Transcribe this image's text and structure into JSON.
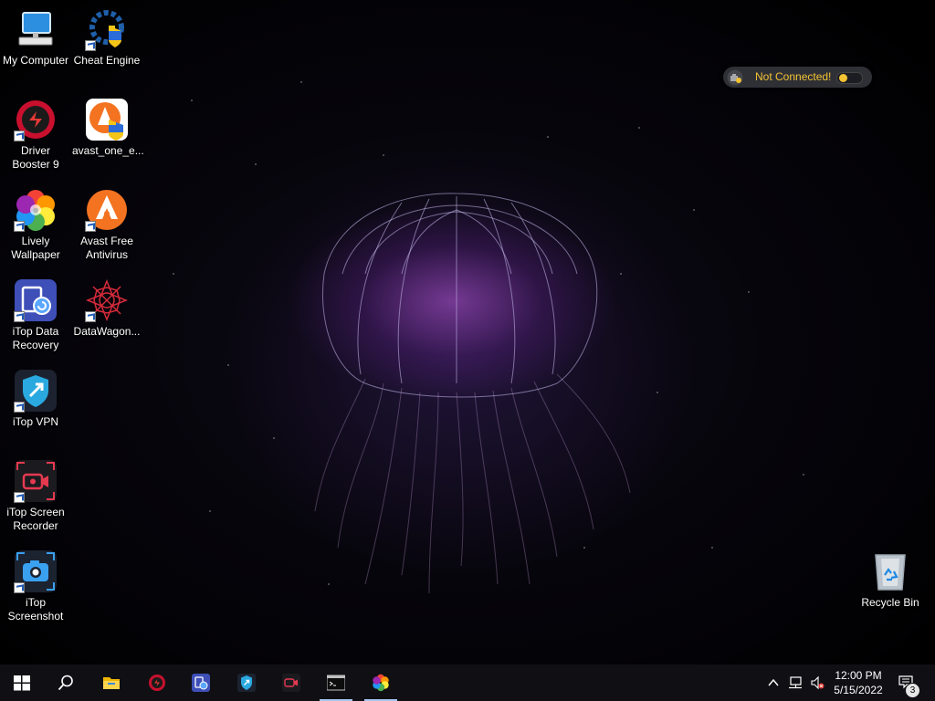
{
  "desktop": {
    "icons": [
      {
        "label": "My Computer",
        "icon": "computer-icon"
      },
      {
        "label": "Cheat Engine",
        "icon": "cheat-engine-icon"
      },
      {
        "label": "Driver Booster 9",
        "icon": "driver-booster-icon"
      },
      {
        "label": "avast_one_e...",
        "icon": "avast-one-installer-icon"
      },
      {
        "label": "Lively Wallpaper",
        "icon": "lively-wallpaper-icon"
      },
      {
        "label": "Avast Free Antivirus",
        "icon": "avast-icon"
      },
      {
        "label": "iTop Data Recovery",
        "icon": "itop-data-recovery-icon"
      },
      {
        "label": "DataWagon...",
        "icon": "datawagon-icon"
      },
      {
        "label": "iTop VPN",
        "icon": "itop-vpn-icon"
      },
      {
        "label": "iTop Screen Recorder",
        "icon": "itop-screen-recorder-icon"
      },
      {
        "label": "iTop Screenshot",
        "icon": "itop-screenshot-icon"
      },
      {
        "label": "Recycle Bin",
        "icon": "recycle-bin-icon"
      }
    ]
  },
  "vpn_widget": {
    "status": "Not Connected!",
    "status_color": "#f1c232"
  },
  "taskbar": {
    "buttons": [
      {
        "icon": "windows-start-icon"
      },
      {
        "icon": "search-icon"
      },
      {
        "icon": "file-explorer-icon"
      },
      {
        "icon": "driver-booster-icon"
      },
      {
        "icon": "itop-data-recovery-icon"
      },
      {
        "icon": "itop-vpn-icon"
      },
      {
        "icon": "itop-screen-recorder-icon"
      },
      {
        "icon": "command-prompt-icon"
      },
      {
        "icon": "lively-wallpaper-icon"
      }
    ],
    "tray": {
      "icons": [
        "chevron-up-icon",
        "network-icon",
        "volume-muted-icon"
      ],
      "time": "12:00 PM",
      "date": "5/15/2022",
      "notification_count": "3"
    }
  }
}
